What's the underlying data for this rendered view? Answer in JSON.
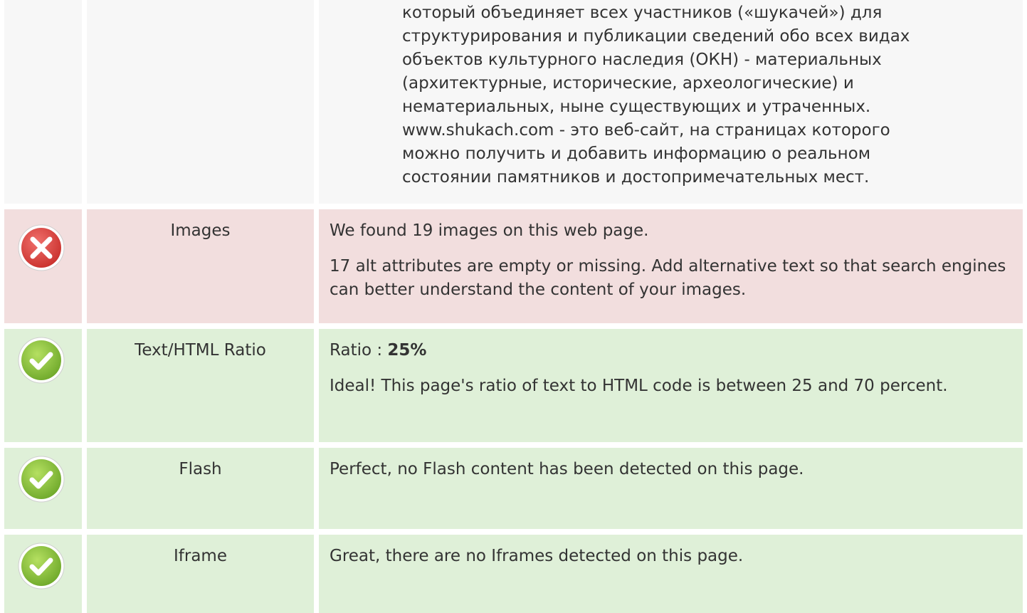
{
  "description": {
    "text": "который объединяет всех участников («шукачей») для\nструктурирования и публикации сведений обо всех видах\nобъектов культурного наследия (ОКН) - материальных\n(архитектурные, исторические, археологические) и\nнематериальных, ныне существующих и утраченных.\nwww.shukach.com - это веб-сайт, на страницах которого\nможно получить и добавить информацию о реальном\nсостоянии памятников и достопримечательных мест."
  },
  "checks": {
    "images": {
      "status": "error",
      "icon": "error-x-icon",
      "label": "Images",
      "line1": "We found 19 images on this web page.",
      "line2": "17 alt attributes are empty or missing. Add alternative text so that search engines can better understand the content of your images."
    },
    "ratio": {
      "status": "ok",
      "icon": "check-icon",
      "label": "Text/HTML Ratio",
      "ratio_prefix": "Ratio : ",
      "ratio_value": "25%",
      "line2": "Ideal! This page's ratio of text to HTML code is between 25 and 70 percent."
    },
    "flash": {
      "status": "ok",
      "icon": "check-icon",
      "label": "Flash",
      "line1": "Perfect, no Flash content has been detected on this page."
    },
    "iframe": {
      "status": "ok",
      "icon": "check-icon",
      "label": "Iframe",
      "line1": "Great, there are no Iframes detected on this page."
    }
  },
  "colors": {
    "error_bg": "#f2dede",
    "ok_bg": "#dff0d8",
    "neutral_bg": "#f7f7f7",
    "error_icon": "#d9534f",
    "ok_icon": "#8cc63f"
  }
}
